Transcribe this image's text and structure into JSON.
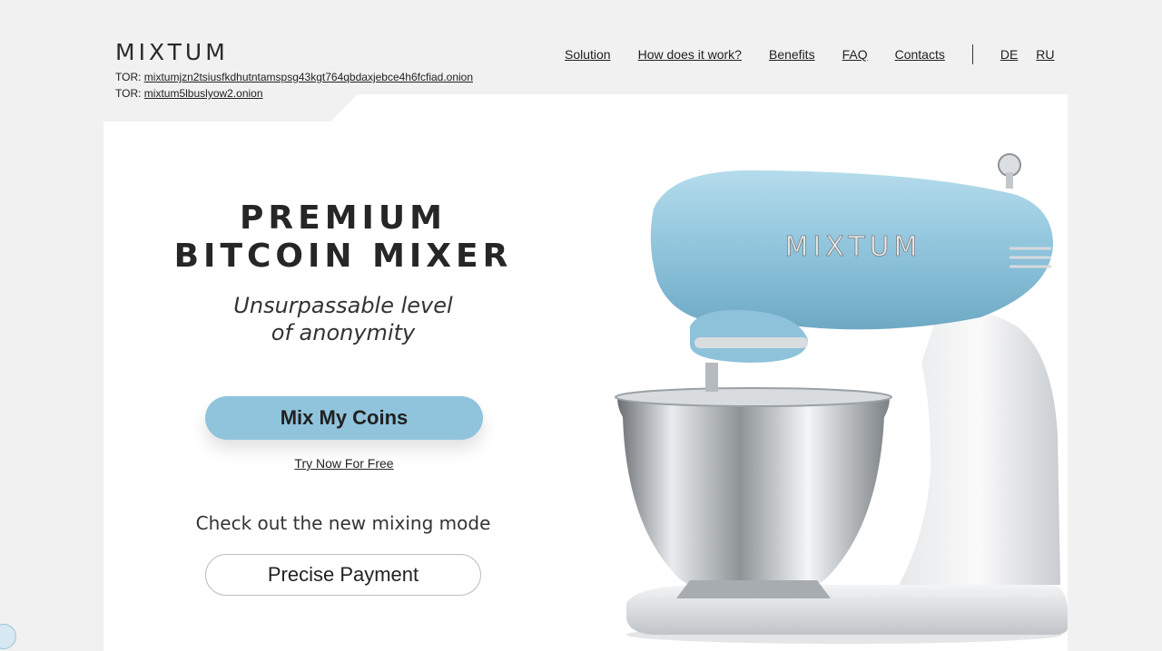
{
  "header": {
    "logo": "MIXTUM",
    "tor": [
      {
        "label": "TOR:",
        "address": "mixtumjzn2tsiusfkdhutntamspsg43kgt764qbdaxjebce4h6fcfiad.onion"
      },
      {
        "label": "TOR:",
        "address": "mixtum5lbuslyow2.onion"
      }
    ],
    "nav": [
      "Solution",
      "How does it work?",
      "Benefits",
      "FAQ",
      "Contacts"
    ],
    "languages": [
      "DE",
      "RU"
    ]
  },
  "hero": {
    "title_line1": "PREMIUM",
    "title_line2": "BITCOIN MIXER",
    "subtitle_line1": "Unsurpassable level",
    "subtitle_line2": "of anonymity",
    "mix_button": "Mix My Coins",
    "try_link": "Try Now For Free",
    "check_text": "Check out the new mixing mode",
    "precise_button": "Precise Payment"
  },
  "illustration": {
    "mixer_brand": "MIXTUM",
    "colors": {
      "body": "#8fc4dc",
      "steel": "#c8ccd0",
      "accent": "#90c4dc"
    }
  }
}
